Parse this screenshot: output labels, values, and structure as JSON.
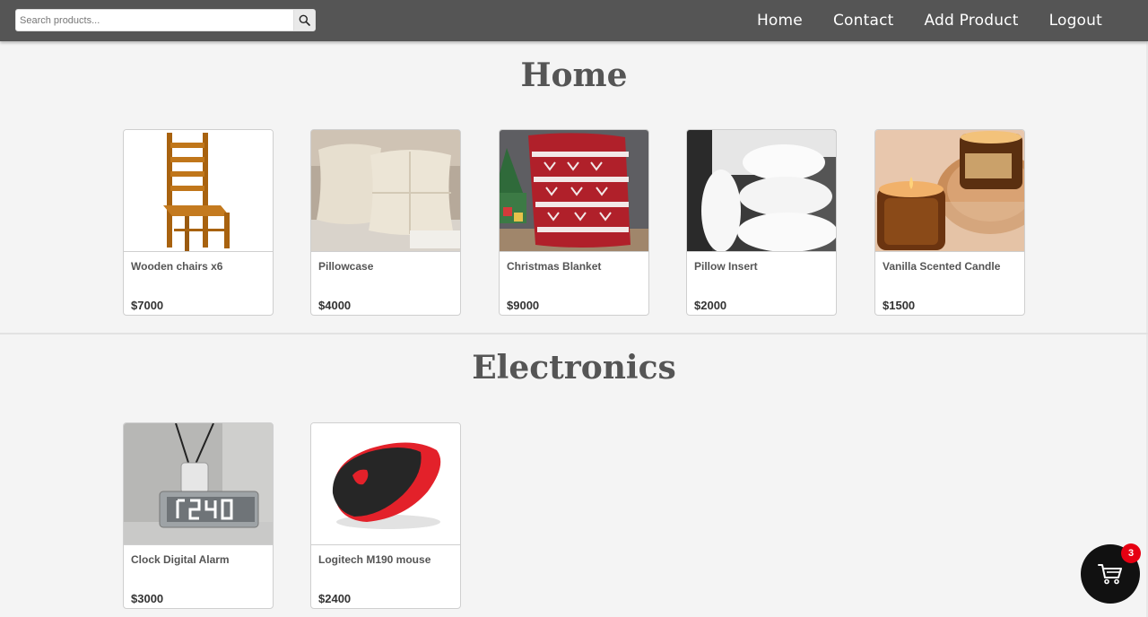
{
  "search": {
    "placeholder": "Search products...",
    "value": ""
  },
  "nav": {
    "items": [
      "Home",
      "Contact",
      "Add Product",
      "Logout"
    ]
  },
  "sections": [
    {
      "title": "Home",
      "products": [
        {
          "name": "Wooden chairs x6",
          "price": "$7000",
          "image": "wooden-chair"
        },
        {
          "name": "Pillowcase",
          "price": "$4000",
          "image": "pillowcase"
        },
        {
          "name": "Christmas Blanket",
          "price": "$9000",
          "image": "christmas-blanket"
        },
        {
          "name": "Pillow Insert",
          "price": "$2000",
          "image": "pillow-insert"
        },
        {
          "name": "Vanilla Scented Candle",
          "price": "$1500",
          "image": "candle"
        }
      ]
    },
    {
      "title": "Electronics",
      "products": [
        {
          "name": "Clock Digital Alarm",
          "price": "$3000",
          "image": "digital-clock"
        },
        {
          "name": "Logitech M190 mouse",
          "price": "$2400",
          "image": "computer-mouse"
        }
      ]
    }
  ],
  "cart": {
    "count": "3"
  },
  "colors": {
    "navbar": "#555555",
    "background": "#f4f4f4",
    "badge": "#e60012"
  }
}
